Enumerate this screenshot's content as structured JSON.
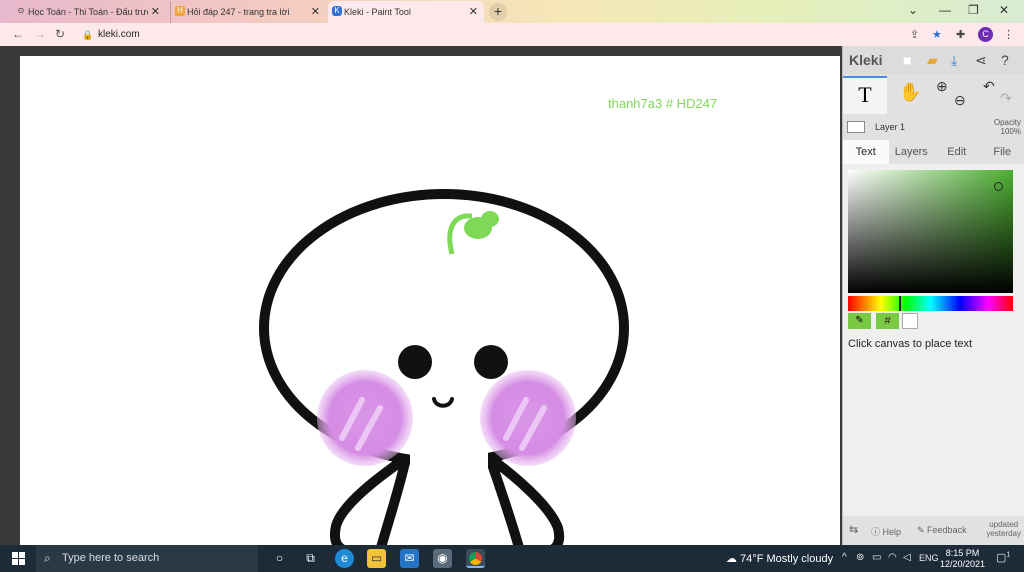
{
  "browser": {
    "tabs": [
      {
        "label": "Học Toán - Thi Toán - Đấu trường",
        "active": false
      },
      {
        "label": "Hỏi đáp 247 - trang tra lời",
        "active": false
      },
      {
        "label": "Kleki - Paint Tool",
        "active": true
      }
    ],
    "new_tab_icon": "+",
    "url": "kleki.com",
    "profile_initial": "C"
  },
  "canvas": {
    "watermark": "thanh7a3 # HD247"
  },
  "kleki": {
    "logo": "Kleki",
    "tool_text_glyph": "T",
    "layer_name": "Layer 1",
    "opacity_label": "Opacity",
    "opacity_value": "100%",
    "tabs": [
      "Text",
      "Layers",
      "Edit",
      "File"
    ],
    "active_tab": "Text",
    "hex_symbol": "#",
    "hint": "Click canvas to place text",
    "footer": {
      "help": "Help",
      "feedback": "Feedback",
      "updated_line1": "updated",
      "updated_line2": "yesterday"
    },
    "colors": {
      "primary": "#7ac942",
      "secondary": "#ffffff"
    }
  },
  "taskbar": {
    "search_placeholder": "Type here to search",
    "weather": "74°F  Mostly cloudy",
    "language": "ENG",
    "time": "8:15 PM",
    "date": "12/20/2021",
    "notification_count": "1"
  }
}
